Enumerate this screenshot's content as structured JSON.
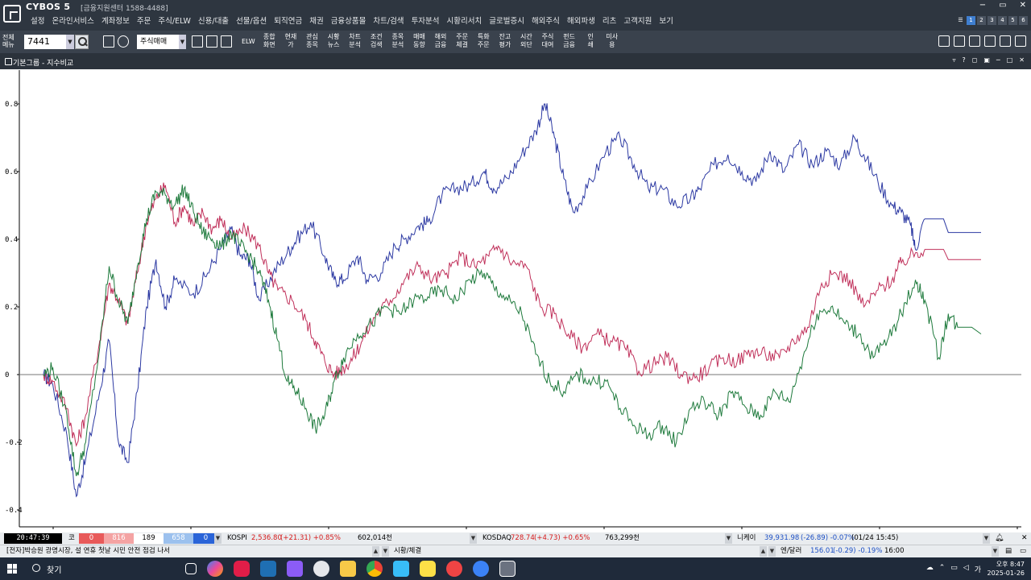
{
  "title_bar": {
    "app_name": "CYBOS 5",
    "support": "[금융지원센터 1588-4488]",
    "menu": [
      "설정",
      "온라인서비스",
      "계좌정보",
      "주문",
      "주식/ELW",
      "신용/대출",
      "선물/옵션",
      "퇴직연금",
      "채권",
      "금융상품몰",
      "차트/검색",
      "투자분석",
      "시황리서치",
      "글로벌증시",
      "해외주식",
      "해외파생",
      "리츠",
      "고객지원",
      "보기"
    ],
    "window_controls": [
      "−",
      "▭",
      "✕"
    ],
    "pages": [
      "1",
      "2",
      "3",
      "4",
      "5",
      "6"
    ]
  },
  "toolbar": {
    "all_menu": "전체\n메뉴",
    "code": "7441",
    "mode": "주식매매",
    "elw": "ELW",
    "buttons": [
      "종합\n화면",
      "현재\n가",
      "관심\n종목",
      "시황\n뉴스",
      "차트\n분석",
      "조건\n검색",
      "종목\n분석",
      "매매\n동향",
      "해외\n금융",
      "주문\n체결",
      "특화\n주문",
      "잔고\n평가",
      "시간\n외단",
      "주식\n대여",
      "펀드\n금융",
      "인\n쇄",
      "미사\n용"
    ]
  },
  "subwindow": {
    "title": "기본그룹 - 지수비교"
  },
  "chart_data": {
    "type": "line",
    "title": "",
    "xlabel": "",
    "ylabel": "",
    "ylim": [
      -0.45,
      0.9
    ],
    "yticks": [
      "0.8",
      "0.6",
      "0.4",
      "0.2",
      "0",
      "-0.2",
      "-0.4"
    ],
    "grid": false,
    "series": [
      {
        "color": "#2d3aa3",
        "points": [
          [
            0,
            0.0
          ],
          [
            0.01,
            -0.03
          ],
          [
            0.025,
            -0.18
          ],
          [
            0.035,
            -0.36
          ],
          [
            0.045,
            -0.25
          ],
          [
            0.06,
            -0.05
          ],
          [
            0.07,
            0.1
          ],
          [
            0.08,
            -0.2
          ],
          [
            0.09,
            -0.26
          ],
          [
            0.1,
            -0.05
          ],
          [
            0.11,
            0.2
          ],
          [
            0.12,
            0.34
          ],
          [
            0.13,
            0.2
          ],
          [
            0.14,
            0.28
          ],
          [
            0.16,
            0.24
          ],
          [
            0.175,
            0.3
          ],
          [
            0.19,
            0.38
          ],
          [
            0.2,
            0.43
          ],
          [
            0.21,
            0.35
          ],
          [
            0.22,
            0.34
          ],
          [
            0.23,
            0.22
          ],
          [
            0.245,
            0.3
          ],
          [
            0.26,
            0.36
          ],
          [
            0.27,
            0.4
          ],
          [
            0.285,
            0.45
          ],
          [
            0.3,
            0.35
          ],
          [
            0.31,
            0.28
          ],
          [
            0.32,
            0.28
          ],
          [
            0.335,
            0.35
          ],
          [
            0.345,
            0.28
          ],
          [
            0.36,
            0.3
          ],
          [
            0.375,
            0.38
          ],
          [
            0.385,
            0.4
          ],
          [
            0.4,
            0.44
          ],
          [
            0.41,
            0.45
          ],
          [
            0.425,
            0.53
          ],
          [
            0.44,
            0.55
          ],
          [
            0.455,
            0.56
          ],
          [
            0.47,
            0.6
          ],
          [
            0.48,
            0.55
          ],
          [
            0.495,
            0.58
          ],
          [
            0.51,
            0.65
          ],
          [
            0.525,
            0.72
          ],
          [
            0.535,
            0.8
          ],
          [
            0.545,
            0.7
          ],
          [
            0.555,
            0.58
          ],
          [
            0.565,
            0.48
          ],
          [
            0.58,
            0.55
          ],
          [
            0.6,
            0.66
          ],
          [
            0.615,
            0.7
          ],
          [
            0.63,
            0.62
          ],
          [
            0.645,
            0.55
          ],
          [
            0.66,
            0.55
          ],
          [
            0.675,
            0.5
          ],
          [
            0.69,
            0.52
          ],
          [
            0.7,
            0.55
          ],
          [
            0.715,
            0.62
          ],
          [
            0.73,
            0.65
          ],
          [
            0.745,
            0.6
          ],
          [
            0.76,
            0.57
          ],
          [
            0.775,
            0.66
          ],
          [
            0.79,
            0.6
          ],
          [
            0.805,
            0.68
          ],
          [
            0.82,
            0.62
          ],
          [
            0.835,
            0.66
          ],
          [
            0.85,
            0.62
          ],
          [
            0.865,
            0.7
          ],
          [
            0.875,
            0.65
          ],
          [
            0.89,
            0.57
          ],
          [
            0.905,
            0.5
          ],
          [
            0.915,
            0.48
          ],
          [
            0.925,
            0.44
          ],
          [
            0.93,
            0.37
          ],
          [
            0.94,
            0.46
          ],
          [
            0.96,
            0.46
          ],
          [
            0.965,
            0.42
          ],
          [
            1.0,
            0.42
          ]
        ]
      },
      {
        "color": "#c0305a",
        "points": [
          [
            0,
            0.0
          ],
          [
            0.01,
            -0.02
          ],
          [
            0.025,
            -0.1
          ],
          [
            0.035,
            -0.21
          ],
          [
            0.045,
            -0.12
          ],
          [
            0.06,
            0.1
          ],
          [
            0.07,
            0.27
          ],
          [
            0.08,
            0.22
          ],
          [
            0.09,
            0.15
          ],
          [
            0.1,
            0.3
          ],
          [
            0.11,
            0.45
          ],
          [
            0.12,
            0.52
          ],
          [
            0.13,
            0.56
          ],
          [
            0.14,
            0.45
          ],
          [
            0.15,
            0.5
          ],
          [
            0.16,
            0.44
          ],
          [
            0.17,
            0.48
          ],
          [
            0.18,
            0.43
          ],
          [
            0.19,
            0.46
          ],
          [
            0.2,
            0.4
          ],
          [
            0.215,
            0.43
          ],
          [
            0.23,
            0.38
          ],
          [
            0.24,
            0.3
          ],
          [
            0.25,
            0.25
          ],
          [
            0.265,
            0.22
          ],
          [
            0.28,
            0.16
          ],
          [
            0.29,
            0.1
          ],
          [
            0.3,
            0.04
          ],
          [
            0.31,
            0.0
          ],
          [
            0.32,
            0.02
          ],
          [
            0.33,
            0.05
          ],
          [
            0.34,
            0.1
          ],
          [
            0.355,
            0.18
          ],
          [
            0.37,
            0.22
          ],
          [
            0.385,
            0.28
          ],
          [
            0.4,
            0.32
          ],
          [
            0.415,
            0.28
          ],
          [
            0.43,
            0.3
          ],
          [
            0.445,
            0.35
          ],
          [
            0.46,
            0.32
          ],
          [
            0.475,
            0.35
          ],
          [
            0.485,
            0.38
          ],
          [
            0.5,
            0.33
          ],
          [
            0.515,
            0.32
          ],
          [
            0.53,
            0.2
          ],
          [
            0.545,
            0.18
          ],
          [
            0.56,
            0.12
          ],
          [
            0.575,
            0.08
          ],
          [
            0.59,
            0.12
          ],
          [
            0.605,
            0.1
          ],
          [
            0.62,
            0.08
          ],
          [
            0.635,
            0.01
          ],
          [
            0.65,
            0.03
          ],
          [
            0.665,
            0.05
          ],
          [
            0.68,
            0.0
          ],
          [
            0.695,
            -0.01
          ],
          [
            0.71,
            0.02
          ],
          [
            0.725,
            0.05
          ],
          [
            0.74,
            0.04
          ],
          [
            0.755,
            0.07
          ],
          [
            0.77,
            0.06
          ],
          [
            0.785,
            0.05
          ],
          [
            0.8,
            0.1
          ],
          [
            0.815,
            0.14
          ],
          [
            0.83,
            0.27
          ],
          [
            0.845,
            0.3
          ],
          [
            0.86,
            0.28
          ],
          [
            0.875,
            0.2
          ],
          [
            0.89,
            0.25
          ],
          [
            0.905,
            0.28
          ],
          [
            0.915,
            0.33
          ],
          [
            0.93,
            0.36
          ],
          [
            0.94,
            0.37
          ],
          [
            0.96,
            0.37
          ],
          [
            0.965,
            0.34
          ],
          [
            1.0,
            0.34
          ]
        ]
      },
      {
        "color": "#1e7a3c",
        "points": [
          [
            0,
            0.0
          ],
          [
            0.01,
            0.02
          ],
          [
            0.025,
            -0.12
          ],
          [
            0.035,
            -0.3
          ],
          [
            0.045,
            -0.2
          ],
          [
            0.06,
            0.08
          ],
          [
            0.07,
            0.32
          ],
          [
            0.08,
            0.22
          ],
          [
            0.09,
            0.15
          ],
          [
            0.1,
            0.32
          ],
          [
            0.11,
            0.46
          ],
          [
            0.12,
            0.54
          ],
          [
            0.13,
            0.53
          ],
          [
            0.14,
            0.5
          ],
          [
            0.15,
            0.55
          ],
          [
            0.16,
            0.48
          ],
          [
            0.17,
            0.42
          ],
          [
            0.18,
            0.4
          ],
          [
            0.19,
            0.38
          ],
          [
            0.2,
            0.42
          ],
          [
            0.21,
            0.38
          ],
          [
            0.22,
            0.35
          ],
          [
            0.23,
            0.3
          ],
          [
            0.24,
            0.22
          ],
          [
            0.25,
            0.1
          ],
          [
            0.26,
            -0.02
          ],
          [
            0.27,
            -0.05
          ],
          [
            0.28,
            -0.1
          ],
          [
            0.29,
            -0.16
          ],
          [
            0.3,
            -0.12
          ],
          [
            0.31,
            -0.02
          ],
          [
            0.32,
            0.05
          ],
          [
            0.335,
            0.12
          ],
          [
            0.35,
            0.15
          ],
          [
            0.365,
            0.2
          ],
          [
            0.38,
            0.18
          ],
          [
            0.395,
            0.22
          ],
          [
            0.41,
            0.23
          ],
          [
            0.425,
            0.25
          ],
          [
            0.44,
            0.22
          ],
          [
            0.455,
            0.28
          ],
          [
            0.47,
            0.3
          ],
          [
            0.48,
            0.26
          ],
          [
            0.495,
            0.22
          ],
          [
            0.51,
            0.18
          ],
          [
            0.525,
            0.06
          ],
          [
            0.54,
            -0.02
          ],
          [
            0.555,
            -0.05
          ],
          [
            0.57,
            0.0
          ],
          [
            0.585,
            -0.02
          ],
          [
            0.6,
            -0.02
          ],
          [
            0.615,
            -0.1
          ],
          [
            0.63,
            -0.15
          ],
          [
            0.645,
            -0.18
          ],
          [
            0.66,
            -0.15
          ],
          [
            0.675,
            -0.2
          ],
          [
            0.69,
            -0.1
          ],
          [
            0.705,
            -0.08
          ],
          [
            0.72,
            -0.12
          ],
          [
            0.735,
            -0.05
          ],
          [
            0.75,
            -0.1
          ],
          [
            0.765,
            -0.12
          ],
          [
            0.78,
            -0.05
          ],
          [
            0.795,
            -0.08
          ],
          [
            0.81,
            0.05
          ],
          [
            0.825,
            0.18
          ],
          [
            0.84,
            0.2
          ],
          [
            0.855,
            0.15
          ],
          [
            0.87,
            0.12
          ],
          [
            0.885,
            0.05
          ],
          [
            0.9,
            0.1
          ],
          [
            0.915,
            0.18
          ],
          [
            0.93,
            0.28
          ],
          [
            0.94,
            0.22
          ],
          [
            0.955,
            0.05
          ],
          [
            0.965,
            0.18
          ],
          [
            0.975,
            0.14
          ],
          [
            0.99,
            0.14
          ],
          [
            1.0,
            0.12
          ]
        ]
      }
    ]
  },
  "status": {
    "clock": "20:47:39",
    "market": "코",
    "counts": [
      {
        "v": "0",
        "c": "#e85a5a"
      },
      {
        "v": "816",
        "c": "#f4a3a3"
      },
      {
        "v": "189",
        "c": "#ffffff"
      },
      {
        "v": "658",
        "c": "#9cc1ee"
      },
      {
        "v": "0",
        "c": "#2a64d8"
      }
    ],
    "kospi_label": "KOSPI",
    "kospi_value": "2,536.80",
    "kospi_change": "(+21.31) +0.85%",
    "kospi_volume": "602,014천",
    "kosdaq_label": "KOSDAQ",
    "kosdaq_value": "728.74",
    "kosdaq_change": "(+4.73) +0.65%",
    "kosdaq_volume": "763,299천",
    "nikkei_label": "니케이",
    "nikkei_value": "39,931.98",
    "nikkei_change": "(-26.89) -0.07%",
    "nikkei_time": "(01/24 15:45)",
    "news": "[전자]박승원 광명시장, 설 연휴 첫날 시민 안전 점검 나서",
    "quote_label": "시황/체결",
    "fx_label": "엔/달러",
    "fx_value": "156.01",
    "fx_change": "(-0.29) -0.19%",
    "fx_time": "16:00"
  },
  "taskbar": {
    "search": "찾기",
    "time": "오후 8:47",
    "date": "2025-01-26",
    "lang": "가"
  }
}
